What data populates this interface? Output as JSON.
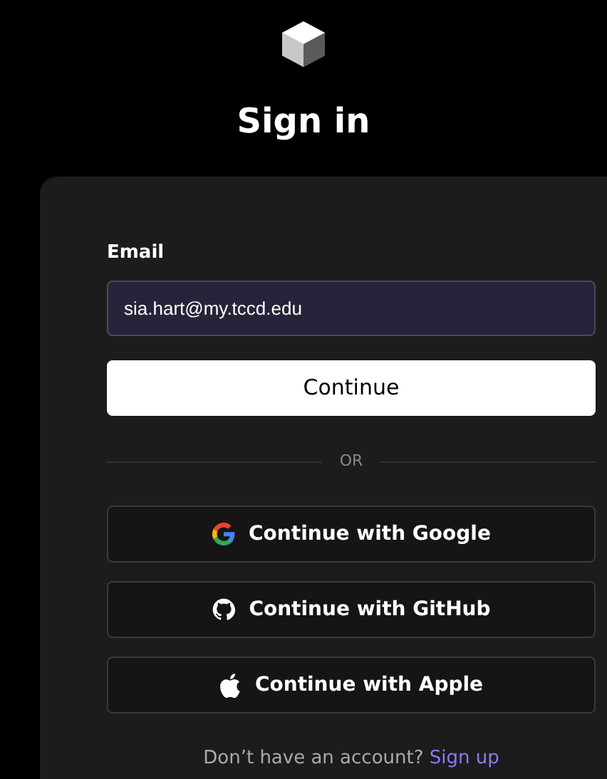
{
  "title": "Sign in",
  "email": {
    "label": "Email",
    "value": "sia.hart@my.tccd.edu"
  },
  "continue_button": "Continue",
  "divider": "OR",
  "providers": [
    {
      "kind": "google",
      "label": "Continue with Google"
    },
    {
      "kind": "github",
      "label": "Continue with GitHub"
    },
    {
      "kind": "apple",
      "label": "Continue with Apple"
    }
  ],
  "footer": {
    "text": "Don’t have an account?",
    "link": "Sign up"
  }
}
